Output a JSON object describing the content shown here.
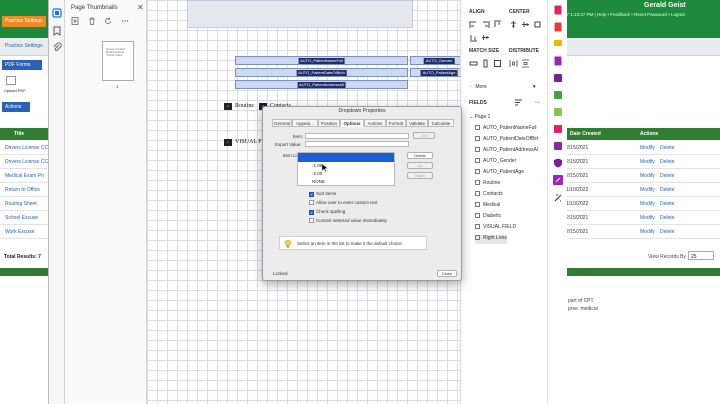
{
  "background_app": {
    "user_name": "Gerald Geist",
    "top_links": "07 1:13:47 PM  |  Help  •  Feedback  •  Reset Password  •  Logout",
    "tab_label": "Practice Settings",
    "subnav_label": "Practice Settings",
    "pdf_forms_btn": "PDF Forms",
    "upload_pdf": "Upload PDF",
    "actions_btn": "Actions",
    "column_title": "Title",
    "column_date": "Date Created",
    "column_actions": "Actions",
    "left_rows": [
      "Drivers License CC",
      "Drivers License CC",
      "Medical Exam Pri",
      "Return to Office",
      "Routing Sheet",
      "School Excuse",
      "Work Excuse"
    ],
    "right_rows": [
      {
        "date": "2/15/2021",
        "modify": "Modify",
        "delete": "Delete"
      },
      {
        "date": "2/15/2021",
        "modify": "Modify",
        "delete": "Delete"
      },
      {
        "date": "2/15/2021",
        "modify": "Modify",
        "delete": "Delete"
      },
      {
        "date": "1/10/2022",
        "modify": "Modify",
        "delete": "Delete"
      },
      {
        "date": "1/10/2022",
        "modify": "Modify",
        "delete": "Delete"
      },
      {
        "date": "2/15/2021",
        "modify": "Modify",
        "delete": "Delete"
      },
      {
        "date": "2/15/2021",
        "modify": "Modify",
        "delete": "Delete"
      }
    ],
    "total_results": "Total Results: 7",
    "view_records": "View Records By",
    "view_records_value": "25",
    "footer_text": "part of CPT,",
    "footer_text2": "prse. medical"
  },
  "thumbnails": {
    "title": "Page Thumbnails",
    "page_number": "1"
  },
  "canvas": {
    "fields": [
      {
        "name": "AUTO_PatientNameFull"
      },
      {
        "name": "AUTO_PatientDateOfBirth"
      },
      {
        "name": "AUTO_PatientAddressAll"
      },
      {
        "name": "AUTO_Gender"
      },
      {
        "name": "AUTO_PatientAge"
      }
    ],
    "labels": {
      "routine": "Routine",
      "contacts": "Contacts",
      "visual_field": "VISUAL FIELD"
    },
    "selected_field": "Right Lens"
  },
  "right_pane": {
    "align": "ALIGN",
    "center": "CENTER",
    "match_size": "MATCH SIZE",
    "distribute": "DISTRIBUTE",
    "more": "More",
    "fields_heading": "FIELDS",
    "page": "Page 1",
    "field_list": [
      "AUTO_PatientNameFull",
      "AUTO_PatientDateOfBirt",
      "AUTO_PatientAddressAl",
      "AUTO_Gender",
      "AUTO_PatientAge",
      "Routine",
      "Contacts",
      "Medical",
      "Diabetic",
      "VISUAL FIELD",
      "Right Lens"
    ]
  },
  "dialog": {
    "title": "Dropdown Properties",
    "tabs": [
      "General",
      "Appear...",
      "Position",
      "Options",
      "Actions",
      "Format",
      "Validate",
      "Calculate"
    ],
    "active_tab": "Options",
    "item_label": "Item:",
    "export_label": "Export Value:",
    "itemlist_label": "Item List:",
    "add_btn": "Add",
    "delete_btn": "Delete",
    "up_btn": "Up",
    "down_btn": "Down",
    "list_items": [
      "-1.00",
      "-2.00",
      "NONE"
    ],
    "selected_item": "-1.00",
    "sort_items": "Sort items",
    "allow_custom": "Allow user to enter custom text",
    "check_spelling": "Check spelling",
    "commit": "Commit selected value immediately",
    "hint": "Select an item in the list to make it the default choice.",
    "locked": "Locked",
    "close_btn": "Close"
  }
}
